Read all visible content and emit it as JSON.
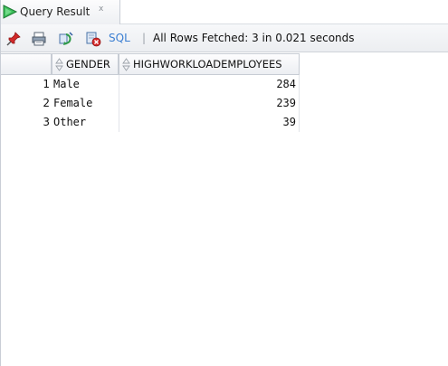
{
  "tab": {
    "title": "Query Result",
    "close_glyph": "x",
    "icon": "run-triangle-icon"
  },
  "toolbar": {
    "icons": [
      "pin-icon",
      "print-icon",
      "refresh-icon",
      "clear-icon"
    ],
    "sql_label": "SQL",
    "separator": "|",
    "status": "All Rows Fetched: 3 in 0.021 seconds"
  },
  "grid": {
    "columns": [
      "GENDER",
      "HIGHWORKLOADEMPLOYEES"
    ],
    "rows": [
      {
        "num": "1",
        "gender": "Male",
        "count": "284"
      },
      {
        "num": "2",
        "gender": "Female",
        "count": "239"
      },
      {
        "num": "3",
        "gender": "Other",
        "count": "39"
      }
    ]
  },
  "colors": {
    "accent_green": "#2fa84f",
    "link_blue": "#3c7fd2"
  }
}
